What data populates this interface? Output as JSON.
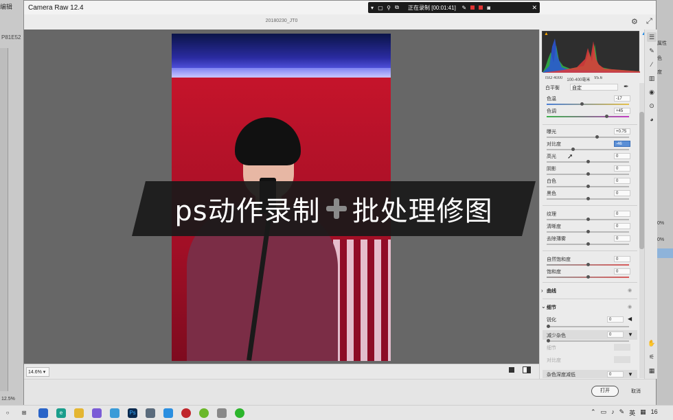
{
  "photoshop": {
    "menu_label": "编辑",
    "doc_tab": "P81E52",
    "zoom": "12.5%",
    "right_items": [
      "属性",
      "色",
      "度"
    ],
    "right_percent_1": "0%",
    "right_percent_2": "0%"
  },
  "window": {
    "title": "Camera Raw 12.4",
    "filename": "20180230_JT0"
  },
  "recorder": {
    "status": "正在录制 [00:01:41]"
  },
  "exif": {
    "iso": "ISO 4000",
    "lens": "100-400毫米",
    "aperture": "f/5.6"
  },
  "white_balance": {
    "label": "白平衡",
    "value": "自定"
  },
  "sliders": [
    {
      "label": "色温",
      "value": "-17",
      "pos": 0.43
    },
    {
      "label": "色调",
      "value": "+45",
      "pos": 0.74
    },
    {
      "label": "曝光",
      "value": "+0.75",
      "pos": 0.62
    },
    {
      "label": "对比度",
      "value": "-46",
      "pos": 0.31
    },
    {
      "label": "高光",
      "value": "0",
      "pos": 0.5
    },
    {
      "label": "阴影",
      "value": "0",
      "pos": 0.5
    },
    {
      "label": "白色",
      "value": "0",
      "pos": 0.5
    },
    {
      "label": "黑色",
      "value": "0",
      "pos": 0.5
    },
    {
      "label": "纹理",
      "value": "0",
      "pos": 0.5
    },
    {
      "label": "清晰度",
      "value": "0",
      "pos": 0.5
    },
    {
      "label": "去除薄雾",
      "value": "0",
      "pos": 0.5
    },
    {
      "label": "自然饱和度",
      "value": "0",
      "pos": 0.5
    },
    {
      "label": "饱和度",
      "value": "0",
      "pos": 0.5
    }
  ],
  "sections": {
    "curve": "曲线",
    "detail": "细节"
  },
  "detail": {
    "sharpen_label": "锐化",
    "sharpen_value": "0",
    "noise_label": "减少杂色",
    "noise_value": "0",
    "detail_label": "细节",
    "contrast_label": "对比度",
    "color_noise_label": "杂色深度减低",
    "color_noise_value": "0"
  },
  "preview": {
    "zoom": "14.6%"
  },
  "footer": {
    "open_label": "打开",
    "cancel_label": "取消"
  },
  "overlay": {
    "left": "ps动作录制",
    "right": "批处理修图"
  },
  "taskbar": {
    "ime": "英",
    "clock": "16"
  }
}
